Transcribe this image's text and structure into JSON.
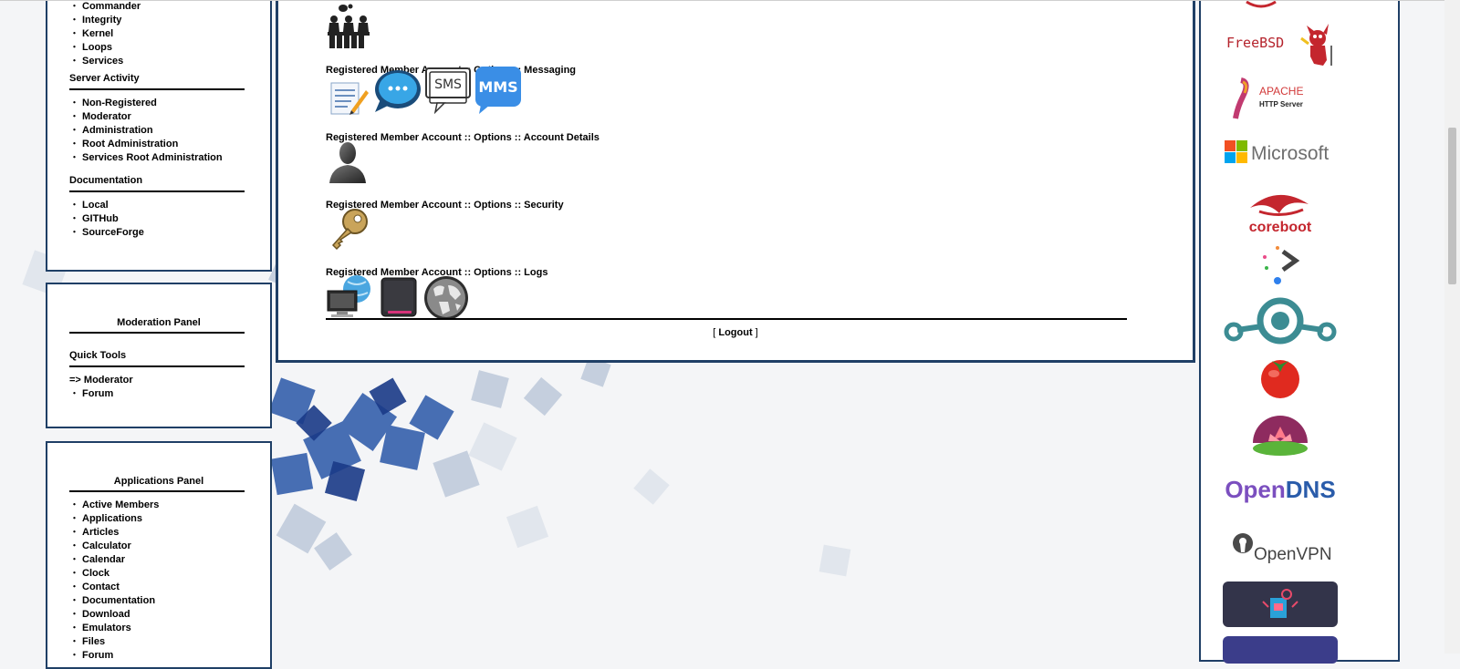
{
  "left_nav": {
    "items_top": [
      "Commander",
      "Integrity",
      "Kernel",
      "Loops",
      "Services"
    ],
    "server_activity": {
      "title": "Server Activity",
      "items": [
        "Non-Registered",
        "Moderator",
        "Administration",
        "Root Administration",
        "Services Root Administration"
      ]
    },
    "documentation": {
      "title": "Documentation",
      "items": [
        "Local",
        "GITHub",
        "SourceForge"
      ]
    }
  },
  "moderation_panel": {
    "title": "Moderation Panel",
    "quick_tools_title": "Quick Tools",
    "moderator_link": "=> Moderator",
    "items": [
      "Forum"
    ]
  },
  "applications_panel": {
    "title": "Applications Panel",
    "items": [
      "Active Members",
      "Applications",
      "Articles",
      "Calculator",
      "Calendar",
      "Clock",
      "Contact",
      "Documentation",
      "Download",
      "Emulators",
      "Files",
      "Forum"
    ]
  },
  "main": {
    "messaging_label": "Registered Member Account :: Options :: Messaging",
    "account_details_label": "Registered Member Account :: Options :: Account Details",
    "security_label": "Registered Member Account :: Options :: Security",
    "logs_label": "Registered Member Account :: Options :: Logs",
    "logout_open": "[ ",
    "logout_label": "Logout",
    "logout_close": " ]",
    "sms_icon_text": "SMS",
    "mms_icon_text": "MMS"
  },
  "sponsors": {
    "freebsd": "FreeBSD",
    "apache_name": "APACHE",
    "apache_sub": "HTTP Server",
    "microsoft": "Microsoft",
    "coreboot": "coreboot",
    "opendns_a": "Open",
    "opendns_b": "DNS",
    "openvpn": "OpenVPN"
  },
  "colors": {
    "panel_border": "#1f3f66",
    "mms_blue": "#3a8ee6",
    "opendns_purple": "#7b4fbf",
    "opendns_blue": "#2a5caa",
    "coreboot_red": "#c4262e",
    "lineage_teal": "#3c8c93"
  }
}
